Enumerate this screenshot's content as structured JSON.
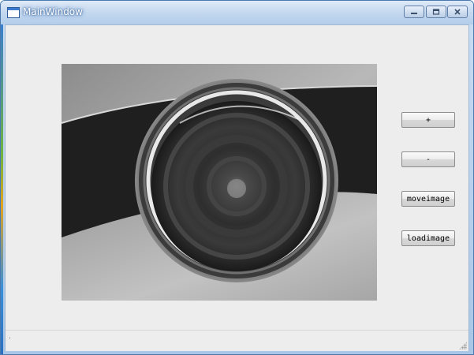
{
  "window": {
    "title": "MainWindow",
    "minimize_icon": "minimize-icon",
    "maximize_icon": "maximize-icon",
    "close_icon": "close-icon"
  },
  "image_view": {
    "content": "grayscale circular lens/seal image"
  },
  "buttons": {
    "zoom_in": "+",
    "zoom_out": "-",
    "move_image": "moveimage",
    "load_image": "loadimage"
  },
  "statusbar": {
    "text": "."
  },
  "colors": {
    "client_bg": "#ededed",
    "titlebar": "#c4d8ef"
  }
}
